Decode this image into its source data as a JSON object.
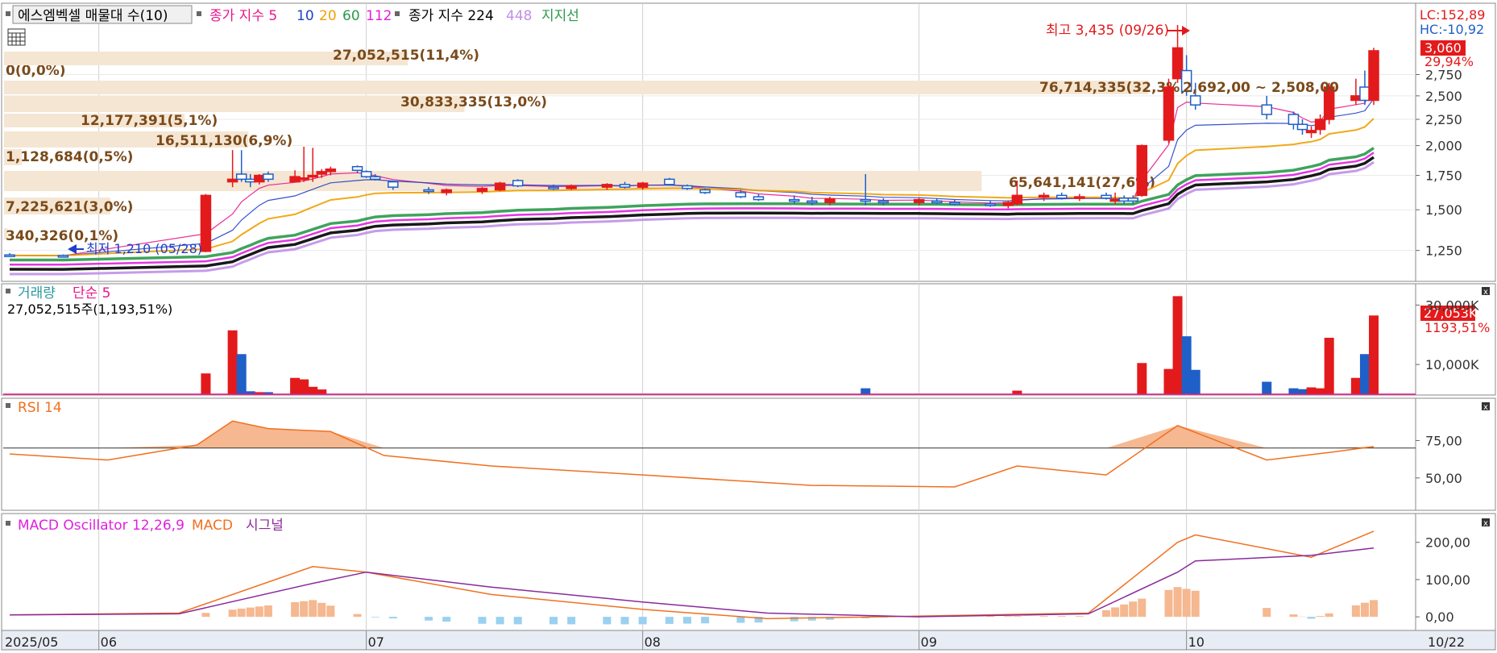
{
  "header": {
    "stock_label": "에스엠벡셀 매물대 수(10)",
    "ma_label": "종가 지수 5",
    "ma_periods": [
      "10",
      "20",
      "60",
      "112"
    ],
    "ma2_label": "종가 지수 224",
    "ma3_period": "448",
    "support_label": "지지선"
  },
  "price_panel": {
    "lc": "LC:152,89",
    "hc": "HC:-10,92",
    "current_price": "3,060",
    "current_change": "29,94%",
    "high_marker": "최고 3,435 (09/26)",
    "low_marker": "최저 1,210 (05/28)",
    "range_label": "2,692,00 ~ 2,508,00",
    "y_ticks": [
      "2,750",
      "2,500",
      "2,250",
      "2,000",
      "1,750",
      "1,500",
      "1,250"
    ]
  },
  "volume_profile": [
    {
      "label": "0(0,0%)",
      "pct": 0.0
    },
    {
      "label": "27,052,515(11,4%)",
      "pct": 11.4
    },
    {
      "label": "76,714,335(32,3%)",
      "pct": 32.3
    },
    {
      "label": "30,833,335(13,0%)",
      "pct": 13.0
    },
    {
      "label": "12,177,391(5,1%)",
      "pct": 5.1
    },
    {
      "label": "16,511,130(6,9%)",
      "pct": 6.9
    },
    {
      "label": "1,128,684(0,5%)",
      "pct": 0.5
    },
    {
      "label": "65,641,141(27,6%)",
      "pct": 27.6
    },
    {
      "label": "7,225,621(3,0%)",
      "pct": 3.0
    },
    {
      "label": "340,326(0,1%)",
      "pct": 0.1
    }
  ],
  "volume_panel": {
    "title": "거래량",
    "ma_label": "단순 5",
    "summary": "27,052,515주(1,193,51%)",
    "y_ticks": [
      "30,000K",
      "10,000K"
    ],
    "current_value": "27,053K",
    "current_pct": "1193,51%"
  },
  "rsi_panel": {
    "title": "RSI 14",
    "y_ticks": [
      "75,00",
      "50,00"
    ]
  },
  "macd_panel": {
    "title": "MACD Oscillator 12,26,9",
    "macd_label": "MACD",
    "signal_label": "시그널",
    "y_ticks": [
      "200,00",
      "100,00",
      "0,00"
    ]
  },
  "x_axis": {
    "labels": [
      "2025/05",
      "06",
      "07",
      "08",
      "09",
      "10",
      "10/22"
    ]
  },
  "colors": {
    "up": "#e31a1c",
    "down": "#1f5fc8",
    "ma5": "#e8168a",
    "ma10": "#1f3fc8",
    "ma20": "#f0a000",
    "ma60": "#2a9a4a",
    "ma112": "#e020e0",
    "ma224": "#000000",
    "ma448": "#c090e8",
    "rsi": "#f07020",
    "macd": "#f07020",
    "signal": "#8a2a9a",
    "osc_pos": "#f5b890",
    "osc_neg": "#9ad0f0",
    "profile": "#f5e6d3",
    "profile_text": "#7a4a1a"
  },
  "chart_data": [
    {
      "type": "candlestick",
      "title": "에스엠벡셀 매물대 수(10)",
      "y_scale": "log",
      "ylim": [
        1100,
        3600
      ],
      "x_start": "2025-05-22",
      "x_end": "2025-10-22",
      "candles": [
        {
          "x": "2025-05-22",
          "o": 1225,
          "h": 1235,
          "l": 1215,
          "c": 1222
        },
        {
          "x": "2025-05-28",
          "o": 1222,
          "h": 1228,
          "l": 1210,
          "c": 1218
        },
        {
          "x": "2025-06-13",
          "o": 1245,
          "h": 1610,
          "l": 1240,
          "c": 1600
        },
        {
          "x": "2025-06-16",
          "o": 1700,
          "h": 1960,
          "l": 1660,
          "c": 1720
        },
        {
          "x": "2025-06-17",
          "o": 1760,
          "h": 1960,
          "l": 1700,
          "c": 1720
        },
        {
          "x": "2025-06-18",
          "o": 1720,
          "h": 1760,
          "l": 1660,
          "c": 1700
        },
        {
          "x": "2025-06-19",
          "o": 1700,
          "h": 1760,
          "l": 1680,
          "c": 1750
        },
        {
          "x": "2025-06-20",
          "o": 1760,
          "h": 1780,
          "l": 1700,
          "c": 1720
        },
        {
          "x": "2025-06-23",
          "o": 1700,
          "h": 1790,
          "l": 1700,
          "c": 1740
        },
        {
          "x": "2025-06-24",
          "o": 1720,
          "h": 1990,
          "l": 1700,
          "c": 1730
        },
        {
          "x": "2025-06-25",
          "o": 1740,
          "h": 1980,
          "l": 1700,
          "c": 1750
        },
        {
          "x": "2025-06-26",
          "o": 1760,
          "h": 1800,
          "l": 1730,
          "c": 1780
        },
        {
          "x": "2025-06-27",
          "o": 1780,
          "h": 1820,
          "l": 1750,
          "c": 1800
        },
        {
          "x": "2025-06-30",
          "o": 1820,
          "h": 1830,
          "l": 1770,
          "c": 1790
        },
        {
          "x": "2025-07-01",
          "o": 1780,
          "h": 1790,
          "l": 1730,
          "c": 1740
        },
        {
          "x": "2025-07-02",
          "o": 1740,
          "h": 1760,
          "l": 1710,
          "c": 1720
        },
        {
          "x": "2025-07-04",
          "o": 1700,
          "h": 1710,
          "l": 1640,
          "c": 1660
        },
        {
          "x": "2025-07-08",
          "o": 1640,
          "h": 1660,
          "l": 1610,
          "c": 1630
        },
        {
          "x": "2025-07-10",
          "o": 1620,
          "h": 1650,
          "l": 1600,
          "c": 1640
        },
        {
          "x": "2025-07-14",
          "o": 1630,
          "h": 1660,
          "l": 1610,
          "c": 1650
        },
        {
          "x": "2025-07-16",
          "o": 1640,
          "h": 1700,
          "l": 1630,
          "c": 1690
        },
        {
          "x": "2025-07-18",
          "o": 1710,
          "h": 1720,
          "l": 1660,
          "c": 1670
        },
        {
          "x": "2025-07-22",
          "o": 1660,
          "h": 1680,
          "l": 1640,
          "c": 1650
        },
        {
          "x": "2025-07-24",
          "o": 1650,
          "h": 1680,
          "l": 1640,
          "c": 1670
        },
        {
          "x": "2025-07-28",
          "o": 1660,
          "h": 1690,
          "l": 1640,
          "c": 1680
        },
        {
          "x": "2025-07-30",
          "o": 1680,
          "h": 1700,
          "l": 1650,
          "c": 1660
        },
        {
          "x": "2025-08-01",
          "o": 1660,
          "h": 1700,
          "l": 1640,
          "c": 1690
        },
        {
          "x": "2025-08-04",
          "o": 1720,
          "h": 1730,
          "l": 1670,
          "c": 1680
        },
        {
          "x": "2025-08-06",
          "o": 1670,
          "h": 1680,
          "l": 1640,
          "c": 1650
        },
        {
          "x": "2025-08-08",
          "o": 1640,
          "h": 1650,
          "l": 1610,
          "c": 1620
        },
        {
          "x": "2025-08-12",
          "o": 1620,
          "h": 1640,
          "l": 1580,
          "c": 1590
        },
        {
          "x": "2025-08-14",
          "o": 1590,
          "h": 1610,
          "l": 1560,
          "c": 1570
        },
        {
          "x": "2025-08-18",
          "o": 1570,
          "h": 1600,
          "l": 1540,
          "c": 1560
        },
        {
          "x": "2025-08-20",
          "o": 1560,
          "h": 1590,
          "l": 1530,
          "c": 1550
        },
        {
          "x": "2025-08-22",
          "o": 1550,
          "h": 1590,
          "l": 1530,
          "c": 1575
        },
        {
          "x": "2025-08-26",
          "o": 1570,
          "h": 1760,
          "l": 1530,
          "c": 1560
        },
        {
          "x": "2025-08-28",
          "o": 1560,
          "h": 1580,
          "l": 1530,
          "c": 1550
        },
        {
          "x": "2025-09-01",
          "o": 1550,
          "h": 1580,
          "l": 1530,
          "c": 1570
        },
        {
          "x": "2025-09-03",
          "o": 1560,
          "h": 1580,
          "l": 1540,
          "c": 1550
        },
        {
          "x": "2025-09-05",
          "o": 1550,
          "h": 1570,
          "l": 1530,
          "c": 1540
        },
        {
          "x": "2025-09-09",
          "o": 1540,
          "h": 1560,
          "l": 1520,
          "c": 1530
        },
        {
          "x": "2025-09-11",
          "o": 1530,
          "h": 1560,
          "l": 1510,
          "c": 1550
        },
        {
          "x": "2025-09-12",
          "o": 1540,
          "h": 1710,
          "l": 1530,
          "c": 1600
        },
        {
          "x": "2025-09-15",
          "o": 1590,
          "h": 1620,
          "l": 1560,
          "c": 1600
        },
        {
          "x": "2025-09-17",
          "o": 1600,
          "h": 1620,
          "l": 1570,
          "c": 1580
        },
        {
          "x": "2025-09-19",
          "o": 1580,
          "h": 1610,
          "l": 1560,
          "c": 1590
        },
        {
          "x": "2025-09-22",
          "o": 1600,
          "h": 1620,
          "l": 1570,
          "c": 1580
        },
        {
          "x": "2025-09-23",
          "o": 1560,
          "h": 1620,
          "l": 1540,
          "c": 1570
        },
        {
          "x": "2025-09-24",
          "o": 1580,
          "h": 1600,
          "l": 1540,
          "c": 1560
        },
        {
          "x": "2025-09-25",
          "o": 1580,
          "h": 1600,
          "l": 1540,
          "c": 1560
        },
        {
          "x": "2025-09-26",
          "o": 1600,
          "h": 2010,
          "l": 1590,
          "c": 2000
        },
        {
          "x": "2025-09-29",
          "o": 2050,
          "h": 2700,
          "l": 2020,
          "c": 2600
        },
        {
          "x": "2025-09-30",
          "o": 2700,
          "h": 3435,
          "l": 2650,
          "c": 3100
        },
        {
          "x": "2025-10-01",
          "o": 2800,
          "h": 3000,
          "l": 2500,
          "c": 2550
        },
        {
          "x": "2025-10-02",
          "o": 2500,
          "h": 2650,
          "l": 2350,
          "c": 2400
        },
        {
          "x": "2025-10-10",
          "o": 2400,
          "h": 2500,
          "l": 2250,
          "c": 2300
        },
        {
          "x": "2025-10-13",
          "o": 2300,
          "h": 2330,
          "l": 2150,
          "c": 2200
        },
        {
          "x": "2025-10-14",
          "o": 2200,
          "h": 2250,
          "l": 2100,
          "c": 2150
        },
        {
          "x": "2025-10-15",
          "o": 2120,
          "h": 2180,
          "l": 2070,
          "c": 2140
        },
        {
          "x": "2025-10-16",
          "o": 2150,
          "h": 2300,
          "l": 2100,
          "c": 2250
        },
        {
          "x": "2025-10-17",
          "o": 2250,
          "h": 2650,
          "l": 2200,
          "c": 2600
        },
        {
          "x": "2025-10-20",
          "o": 2450,
          "h": 2700,
          "l": 2400,
          "c": 2500
        },
        {
          "x": "2025-10-21",
          "o": 2600,
          "h": 2800,
          "l": 2400,
          "c": 2450
        },
        {
          "x": "2025-10-22",
          "o": 2450,
          "h": 3100,
          "l": 2400,
          "c": 3060
        }
      ],
      "moving_averages": [
        {
          "name": "5",
          "period": 5
        },
        {
          "name": "10",
          "period": 10
        },
        {
          "name": "20",
          "period": 20
        },
        {
          "name": "60",
          "period": 60
        },
        {
          "name": "112",
          "period": 112
        },
        {
          "name": "224",
          "period": 224
        },
        {
          "name": "448",
          "period": 448
        }
      ]
    },
    {
      "type": "bar",
      "title": "거래량",
      "ylim": [
        0,
        35000
      ],
      "x": [
        "2025-06-13",
        "2025-06-16",
        "2025-06-17",
        "2025-06-18",
        "2025-06-19",
        "2025-06-20",
        "2025-06-23",
        "2025-06-24",
        "2025-06-25",
        "2025-06-26",
        "2025-08-26",
        "2025-09-12",
        "2025-09-26",
        "2025-09-29",
        "2025-09-30",
        "2025-10-01",
        "2025-10-02",
        "2025-10-10",
        "2025-10-13",
        "2025-10-14",
        "2025-10-15",
        "2025-10-16",
        "2025-10-17",
        "2025-10-20",
        "2025-10-21",
        "2025-10-22"
      ],
      "values": [
        7000,
        21500,
        13500,
        1000,
        700,
        700,
        5500,
        5000,
        2500,
        1600,
        2000,
        1200,
        10500,
        8500,
        33000,
        19500,
        8200,
        4200,
        2000,
        1700,
        2300,
        2000,
        19000,
        5500,
        13500,
        26500
      ],
      "units": "K"
    },
    {
      "type": "line",
      "title": "RSI 14",
      "ylim": [
        30,
        100
      ],
      "x": [
        "2025-05-22",
        "2025-06-02",
        "2025-06-12",
        "2025-06-16",
        "2025-06-20",
        "2025-06-27",
        "2025-07-03",
        "2025-07-15",
        "2025-08-01",
        "2025-08-20",
        "2025-09-05",
        "2025-09-12",
        "2025-09-22",
        "2025-09-30",
        "2025-10-10",
        "2025-10-17",
        "2025-10-22"
      ],
      "values": [
        66,
        62,
        72,
        88,
        83,
        81,
        65,
        58,
        52,
        45,
        44,
        58,
        52,
        85,
        62,
        67,
        71
      ]
    },
    {
      "type": "line",
      "title": "MACD Oscillator 12,26,9",
      "ylim": [
        -30,
        260
      ],
      "x": [
        "2025-05-22",
        "2025-06-10",
        "2025-06-25",
        "2025-07-01",
        "2025-07-15",
        "2025-08-01",
        "2025-08-15",
        "2025-09-01",
        "2025-09-20",
        "2025-09-30",
        "2025-10-02",
        "2025-10-15",
        "2025-10-22"
      ],
      "series": [
        {
          "name": "MACD",
          "values": [
            5,
            10,
            135,
            120,
            60,
            20,
            -5,
            2,
            10,
            200,
            220,
            160,
            230
          ]
        },
        {
          "name": "시그널",
          "values": [
            5,
            8,
            90,
            120,
            80,
            40,
            10,
            0,
            8,
            120,
            150,
            165,
            185
          ]
        }
      ]
    }
  ]
}
